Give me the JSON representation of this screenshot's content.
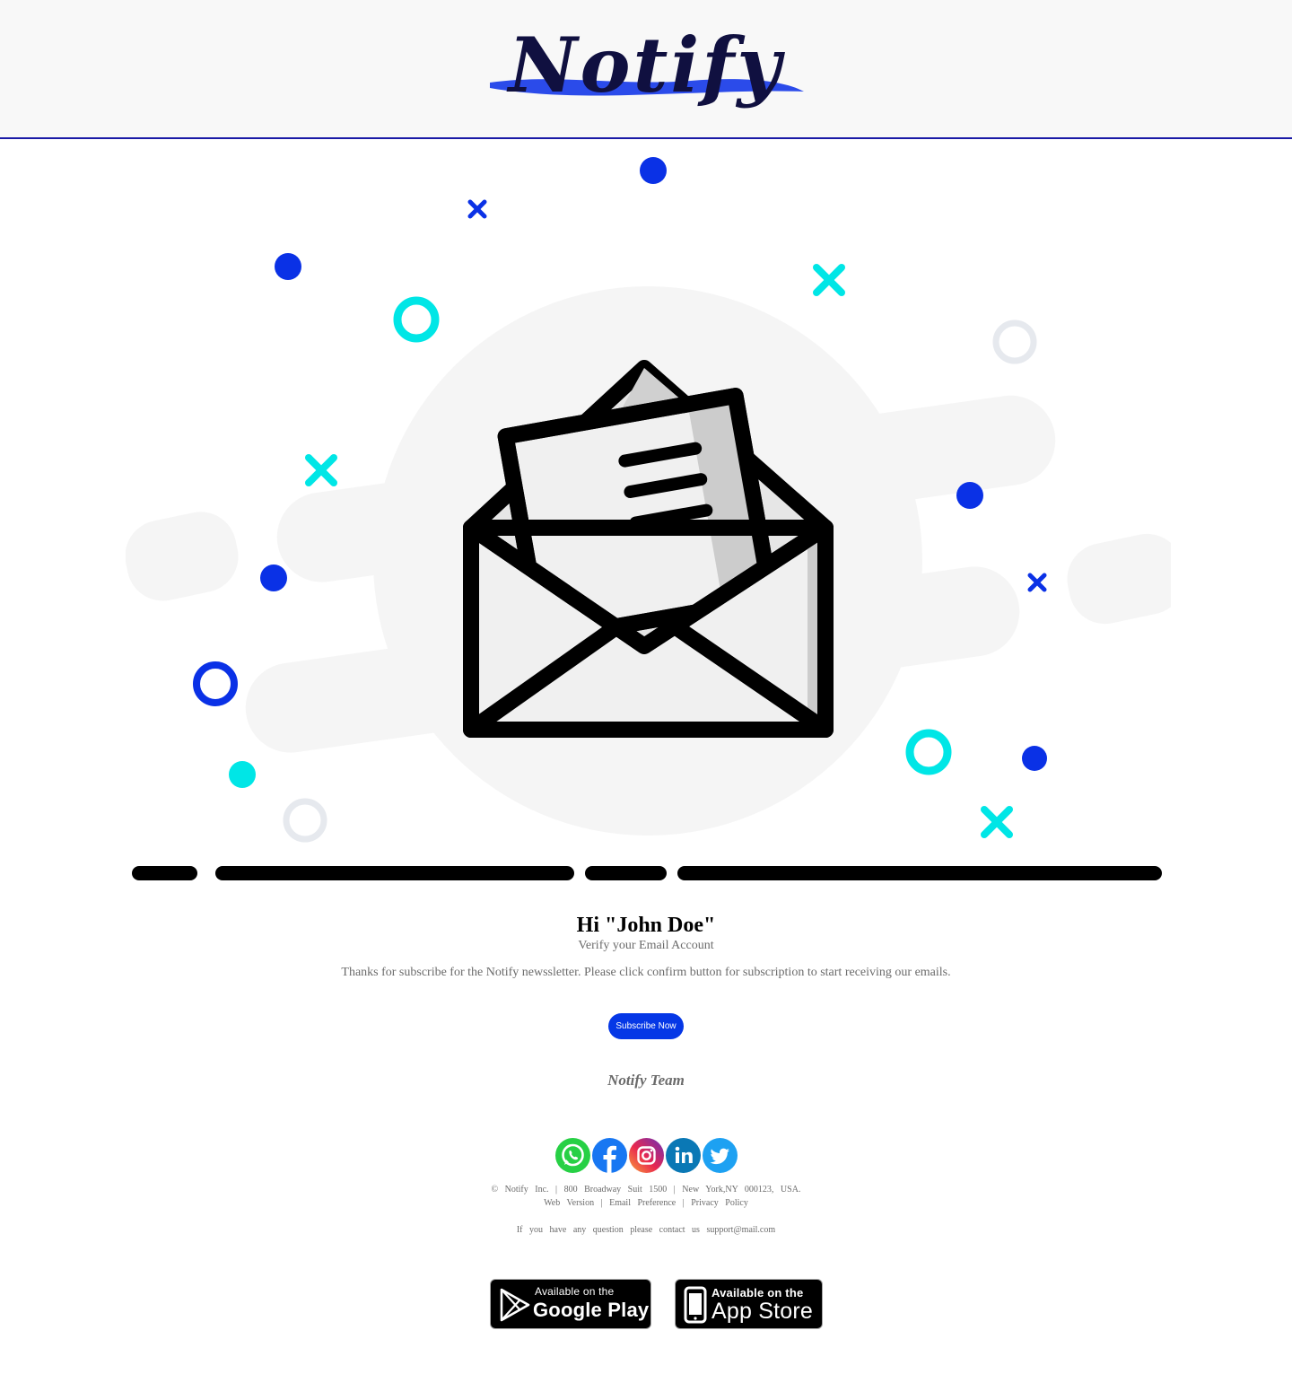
{
  "brand": {
    "logo_text": "Notify",
    "accent_color": "#0537e6",
    "underline_color": "#1a1aa6"
  },
  "hero": {
    "illustration": "open-envelope-with-letter",
    "decor_colors": {
      "blue": "#0a31e6",
      "cyan": "#00e6e6",
      "light_gray": "#e6e9ee",
      "blob_gray": "#f5f5f5"
    }
  },
  "content": {
    "greeting": "Hi \"John Doe\"",
    "subtitle": "Verify your Email Account",
    "message": "Thanks for subscribe for the Notify newssletter. Please click confirm button for subscription to start receiving our emails.",
    "cta_label": "Subscribe Now",
    "signoff": "Notify Team"
  },
  "socials": [
    {
      "name": "WhatsApp",
      "icon": "whatsapp-icon"
    },
    {
      "name": "Facebook",
      "icon": "facebook-icon"
    },
    {
      "name": "Instagram",
      "icon": "instagram-icon"
    },
    {
      "name": "LinkedIn",
      "icon": "linkedin-icon"
    },
    {
      "name": "Twitter",
      "icon": "twitter-icon"
    }
  ],
  "footer": {
    "copyright": "©",
    "company": "Notify Inc.",
    "address": "800 Broadway Suit 1500",
    "city": "New York,NY 000123, USA.",
    "sep": "|",
    "links": [
      "Web Version",
      "Email Preference",
      "Privacy Policy"
    ],
    "contact_text": "If you have any question please contact us",
    "contact_email": "support@mail.com"
  },
  "stores": {
    "google": {
      "small": "Available on the",
      "big": "Google Play"
    },
    "apple": {
      "small": "Available on the",
      "big": "App Store"
    }
  }
}
